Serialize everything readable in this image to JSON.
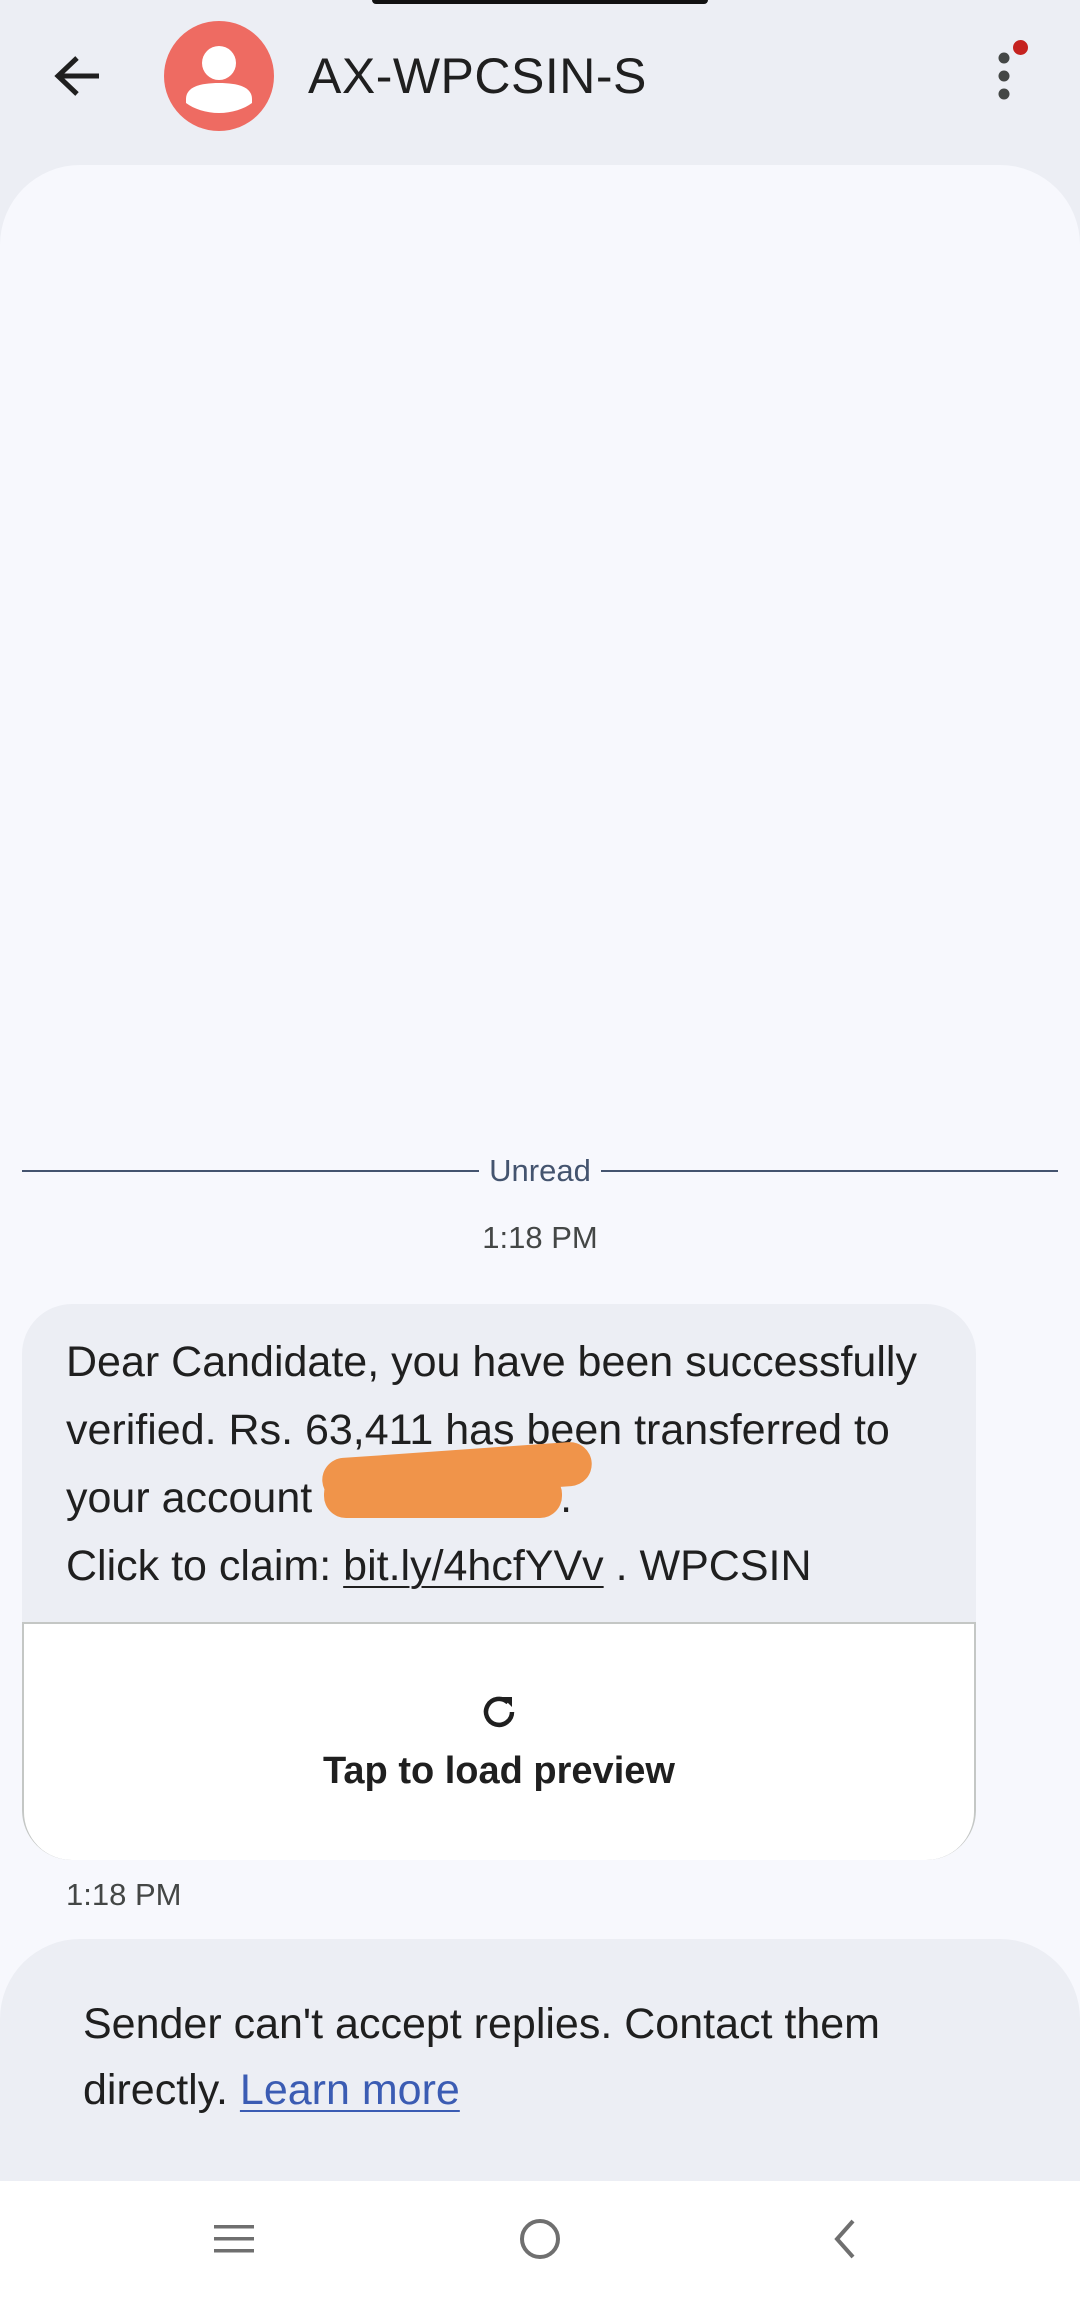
{
  "header": {
    "contact_name": "AX-WPCSIN-S",
    "avatar_color": "#ee6b62",
    "back_icon": "arrow-left-icon",
    "menu_icon": "more-vert-icon",
    "menu_badge_color": "#c5221f"
  },
  "conversation": {
    "unread_label": "Unread",
    "timestamp_top": "1:18 PM",
    "message": {
      "line_1": "Dear Candidate, you have been successfully verified. Rs. 63,411 has been transferred to your account ",
      "after_redaction": ".",
      "line_2_prefix": "Click to claim: ",
      "link": "bit.ly/4hcfYVv",
      "line_2_suffix": " . WPCSIN",
      "redaction_color": "#f0944a"
    },
    "preview": {
      "icon": "refresh-icon",
      "label": "Tap to load preview"
    },
    "timestamp_bottom": "1:18 PM"
  },
  "notice": {
    "text": "Sender can't accept replies. Contact them directly. ",
    "learn_more": "Learn more",
    "link_color": "#3b5cb3"
  },
  "navbar": {
    "recents_icon": "recents-icon",
    "home_icon": "home-icon",
    "back_icon": "nav-back-icon"
  }
}
